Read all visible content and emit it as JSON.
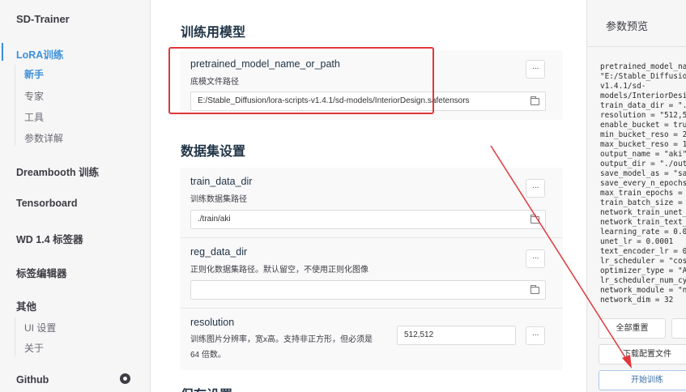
{
  "sidebar": {
    "app_title": "SD-Trainer",
    "items": [
      {
        "label": "LoRA训练",
        "active": true
      },
      {
        "label": "Dreambooth 训练"
      },
      {
        "label": "Tensorboard"
      },
      {
        "label": "WD 1.4 标签器"
      },
      {
        "label": "标签编辑器"
      },
      {
        "label": "其他"
      },
      {
        "label": "Github"
      }
    ],
    "lora_sub": [
      {
        "label": "新手",
        "active": true
      },
      {
        "label": "专家"
      },
      {
        "label": "工具"
      },
      {
        "label": "参数详解"
      }
    ],
    "other_sub": [
      {
        "label": "UI 设置"
      },
      {
        "label": "关于"
      }
    ]
  },
  "main": {
    "model_section_title": "训练用模型",
    "dataset_section_title": "数据集设置",
    "save_section_title": "保存设置",
    "more_label": "···",
    "fields": {
      "pretrained": {
        "label": "pretrained_model_name_or_path",
        "desc": "底模文件路径",
        "value": "E:/Stable_Diffusion/lora-scripts-v1.4.1/sd-models/InteriorDesign.safetensors"
      },
      "train_data_dir": {
        "label": "train_data_dir",
        "desc": "训练数据集路径",
        "value": "./train/aki"
      },
      "reg_data_dir": {
        "label": "reg_data_dir",
        "desc": "正则化数据集路径。默认留空，不使用正则化图像",
        "value": ""
      },
      "resolution": {
        "label": "resolution",
        "desc_line1": "训练图片分辨率，宽x高。支持非正方形，但必须是",
        "desc_line2": "64 倍数。",
        "value": "512,512"
      }
    }
  },
  "preview": {
    "title": "参数预览",
    "code": "pretrained_model_name_or_path =\n\"E:/Stable_Diffusion/lora-scripts-\nv1.4.1/sd-\nmodels/InteriorDesign.safetensors\"\ntrain_data_dir = \"./train/aki\"\nresolution = \"512,512\"\nenable_bucket = true\nmin_bucket_reso = 256\nmax_bucket_reso = 1024\noutput_name = \"aki\"\noutput_dir = \"./output\"\nsave_model_as = \"safetensors\"\nsave_every_n_epochs = 2\nmax_train_epochs = 10\ntrain_batch_size = 1\nnetwork_train_unet_only = false\nnetwork_train_text_encoder_only = false\nlearning_rate = 0.0001\nunet_lr = 0.0001\ntext_encoder_lr = 0.00001\nlr_scheduler = \"cosine_with_restarts\"\noptimizer_type = \"AdamW8bit\"\nlr_scheduler_num_cycles = 1\nnetwork_module = \"networks.lora\"\nnetwork_dim = 32",
    "reset_label": "全部重置",
    "download_label": "下载配置文件",
    "start_label": "开始训练"
  },
  "colors": {
    "accent": "#3a8fd9",
    "highlight_box": "#e0383b",
    "arrow": "#e0383b"
  }
}
